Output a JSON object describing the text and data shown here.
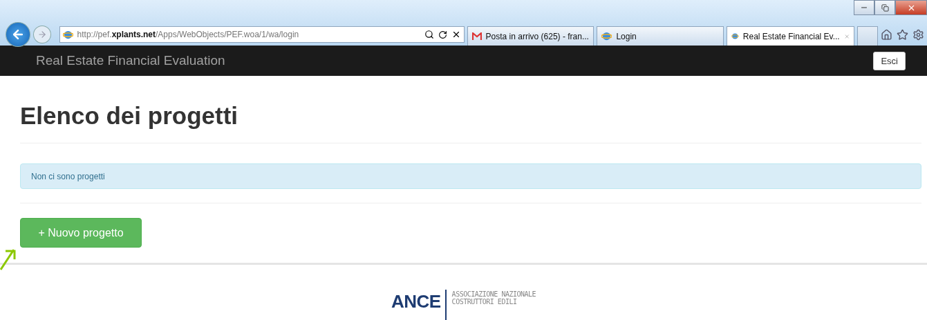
{
  "browser": {
    "address": "http://pef.**xplants.net**/Apps/WebObjects/PEF.woa/1/wa/login",
    "tabs": [
      {
        "kind": "mail",
        "label": "Posta in arrivo (625) - fran...",
        "selected": false
      },
      {
        "kind": "web",
        "label": "Login",
        "selected": false
      },
      {
        "kind": "web",
        "label": "Real Estate Financial Ev...",
        "selected": true
      }
    ]
  },
  "navbar": {
    "brand": "Real Estate Financial Evaluation",
    "button": "Esci"
  },
  "page": {
    "title": "Elenco dei progetti",
    "alert": "Non ci sono progetti",
    "button": "+ Nuovo progetto"
  },
  "footer": {
    "logo": "ANCE",
    "lines": [
      "ASSOCIAZIONE NAZIONALE",
      "COSTRUTTORI EDILI"
    ]
  }
}
